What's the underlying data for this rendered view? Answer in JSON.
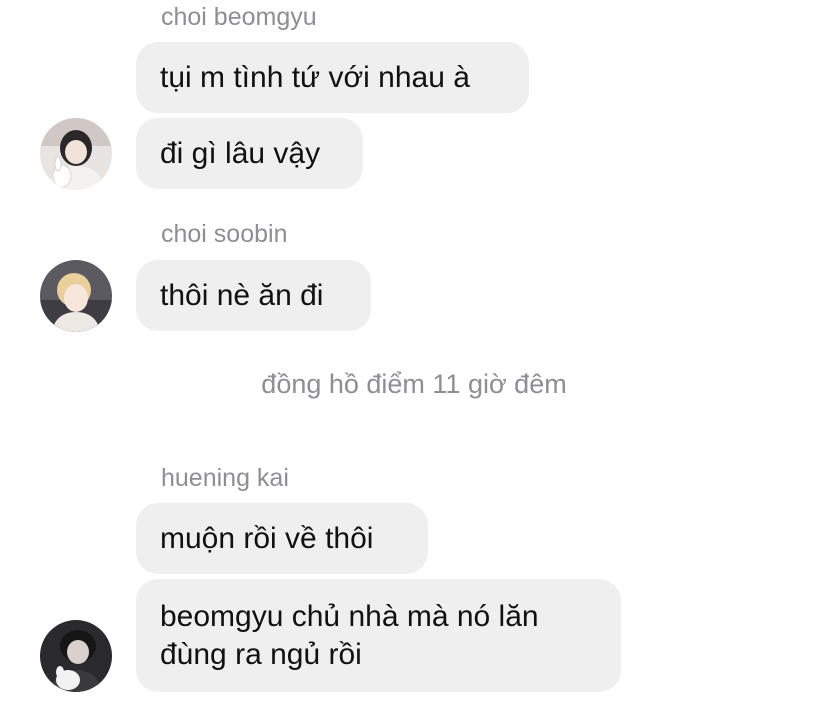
{
  "conversation": {
    "group1": {
      "sender": "choi beomgyu",
      "messages": [
        "tụi m tình tứ với nhau à",
        "đi gì lâu vậy"
      ],
      "avatar_icon": "profile-photo-avatar"
    },
    "group2": {
      "sender": "choi soobin",
      "messages": [
        "thôi nè ăn đi"
      ],
      "avatar_icon": "profile-photo-avatar"
    },
    "system_note": "đồng hồ điểm 11 giờ đêm",
    "group3": {
      "sender": "huening kai",
      "messages": [
        "muộn rồi về thôi"
      ],
      "multiline_message": {
        "line1": "beomgyu chủ nhà mà nó lăn",
        "line2": "đùng ra ngủ rồi"
      },
      "avatar_icon": "profile-photo-avatar"
    }
  },
  "colors": {
    "bubble_bg": "#efeff0",
    "text": "#111111",
    "muted": "#8e8e93",
    "background": "#ffffff"
  }
}
